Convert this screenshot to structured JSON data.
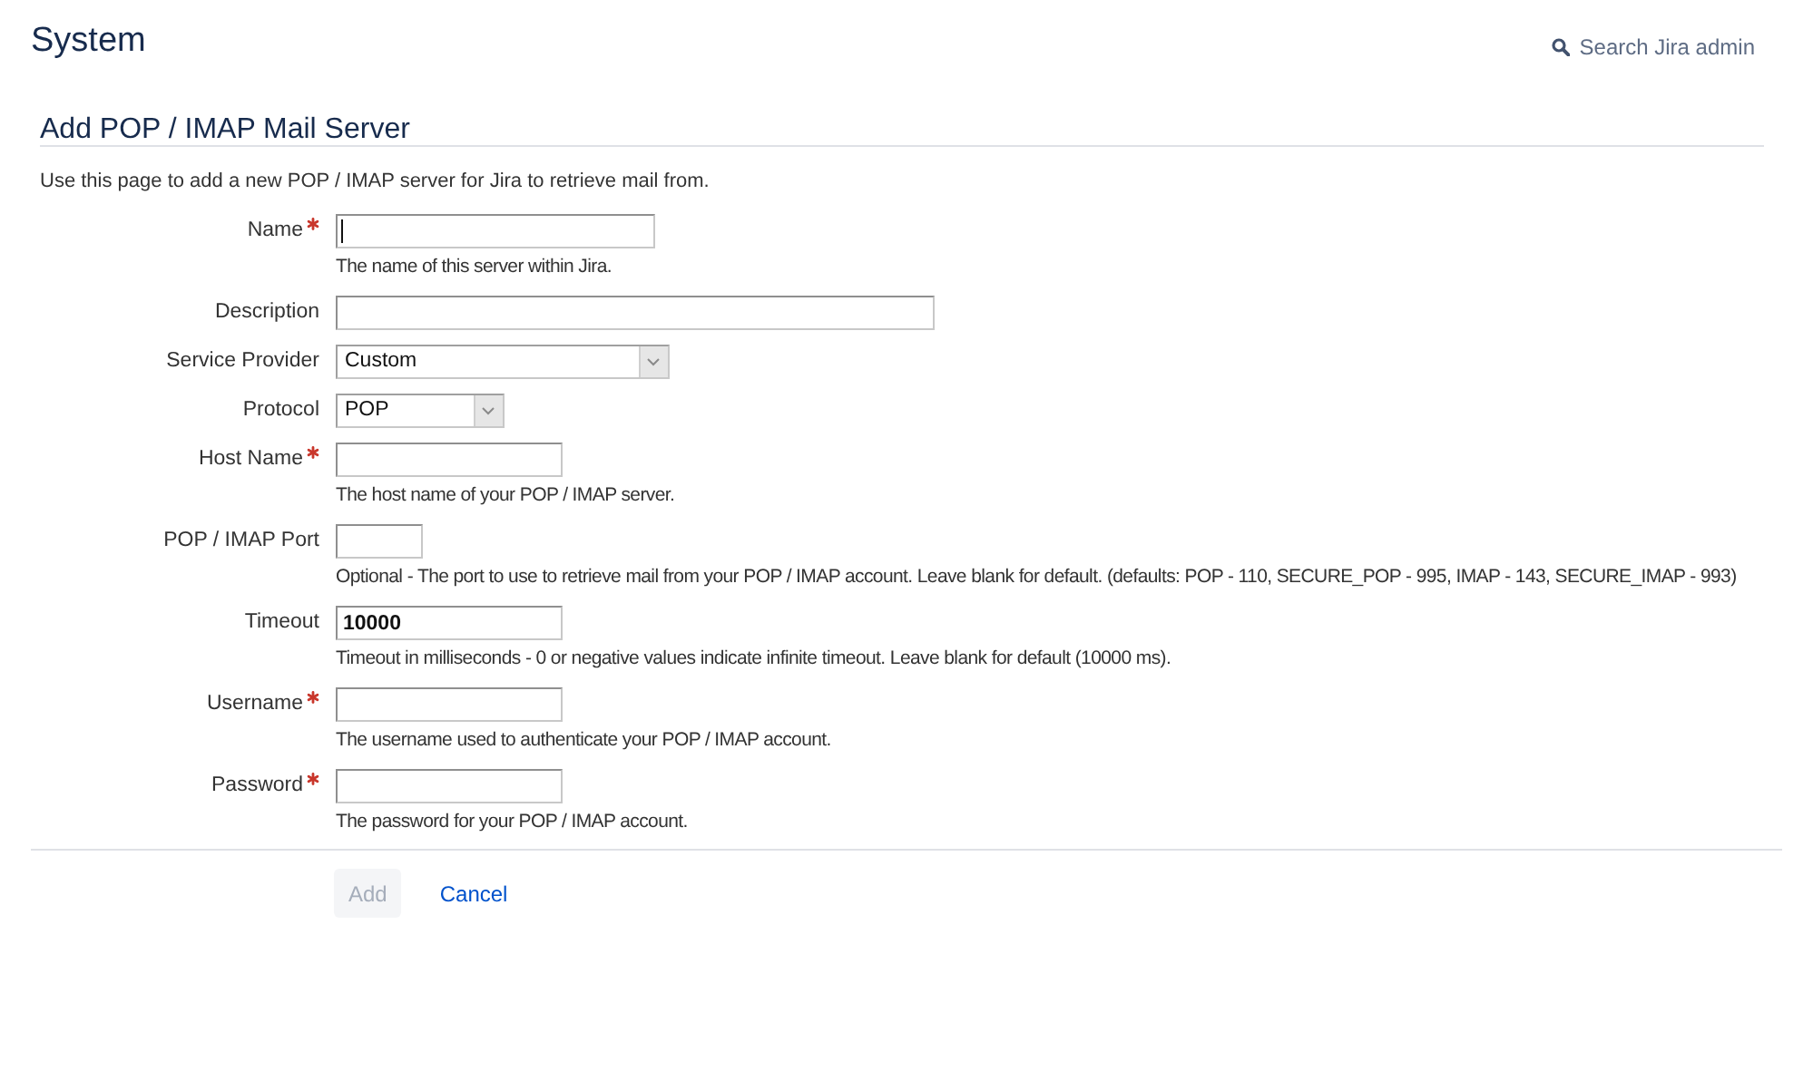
{
  "header": {
    "title": "System",
    "search_link": "Search Jira admin"
  },
  "section": {
    "heading": "Add POP / IMAP Mail Server",
    "intro": "Use this page to add a new POP / IMAP server for Jira to retrieve mail from."
  },
  "form": {
    "fields": [
      {
        "kind": "text",
        "label": "Name",
        "required": true,
        "focused": true,
        "hint": "The name of this server within Jira."
      },
      {
        "kind": "text",
        "label": "Description",
        "required": false,
        "focused": false
      },
      {
        "kind": "select",
        "label": "Service Provider",
        "required": false,
        "focused": false,
        "value": "Custom"
      },
      {
        "kind": "select",
        "label": "Protocol",
        "required": false,
        "focused": false,
        "value": "POP"
      },
      {
        "kind": "text",
        "label": "Host Name",
        "required": true,
        "focused": false,
        "hint": "The host name of your POP / IMAP server."
      },
      {
        "kind": "text",
        "label": "POP / IMAP Port",
        "required": false,
        "focused": false,
        "hint": "Optional - The port to use to retrieve mail from your POP / IMAP account. Leave blank for default. (defaults: POP - 110, SECURE_POP - 995, IMAP - 143, SECURE_IMAP - 993)"
      },
      {
        "kind": "text",
        "label": "Timeout",
        "required": false,
        "focused": false,
        "value": "10000",
        "hint": "Timeout in milliseconds - 0 or negative values indicate infinite timeout. Leave blank for default (10000 ms)."
      },
      {
        "kind": "text",
        "label": "Username",
        "required": true,
        "focused": false,
        "hint": "The username used to authenticate your POP / IMAP account."
      },
      {
        "kind": "password",
        "label": "Password",
        "required": true,
        "focused": false,
        "hint": "The password for your POP / IMAP account."
      }
    ]
  },
  "actions": [
    {
      "kind": "button",
      "label": "Add",
      "disabled": true
    },
    {
      "kind": "link",
      "label": "Cancel"
    }
  ]
}
